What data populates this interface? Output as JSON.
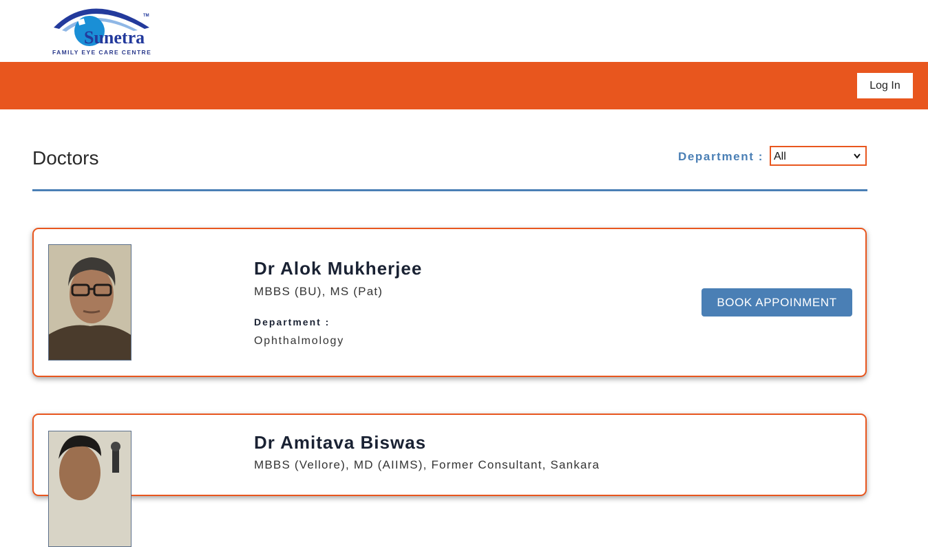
{
  "brand": {
    "name": "Sunetra",
    "tagline": "FAMILY EYE CARE CENTRE",
    "trademark": "TM",
    "primary_color": "#e8561e",
    "accent_color": "#4a7fb5",
    "logo_blue": "#233a9c"
  },
  "nav": {
    "login_label": "Log In"
  },
  "page": {
    "title": "Doctors"
  },
  "filter": {
    "label": "Department :",
    "selected": "All"
  },
  "doctors": [
    {
      "name": "Dr Alok Mukherjee",
      "qualification": "MBBS (BU), MS (Pat)",
      "department_label": "Department :",
      "department": "Ophthalmology",
      "button_label": "BOOK APPOINMENT"
    },
    {
      "name": "Dr Amitava Biswas",
      "qualification": "MBBS (Vellore), MD (AIIMS), Former Consultant, Sankara"
    }
  ]
}
